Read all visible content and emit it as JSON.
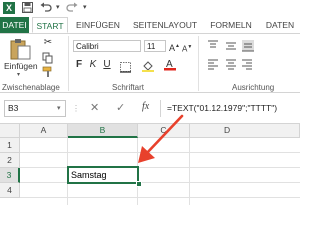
{
  "titlebar": {
    "app_icon": "X",
    "icons": [
      "save-icon",
      "undo-icon",
      "redo-icon",
      "qat-more-icon"
    ]
  },
  "tabs": [
    {
      "label": "DATEI"
    },
    {
      "label": "START"
    },
    {
      "label": "EINFÜGEN"
    },
    {
      "label": "SEITENLAYOUT"
    },
    {
      "label": "FORMELN"
    },
    {
      "label": "DATEN"
    }
  ],
  "ribbon": {
    "clipboard": {
      "paste_label": "Einfügen",
      "group_label": "Zwischenablage"
    },
    "font": {
      "name": "Calibri",
      "size": "11",
      "group_label": "Schriftart",
      "bold": "F",
      "italic": "K",
      "underline": "U"
    },
    "alignment": {
      "group_label": "Ausrichtung"
    }
  },
  "formula_bar": {
    "name_box": "B3",
    "cancel": "✕",
    "confirm": "✓",
    "fx": "fx",
    "formula": "=TEXT(\"01.12.1979\";\"TTTT\")"
  },
  "sheet": {
    "columns": [
      "A",
      "B",
      "C",
      "D"
    ],
    "rows": [
      "1",
      "2",
      "3",
      "4"
    ],
    "selected_cell_value": "Samstag"
  },
  "colors": {
    "accent": "#217346",
    "arrow": "#e8412c"
  }
}
